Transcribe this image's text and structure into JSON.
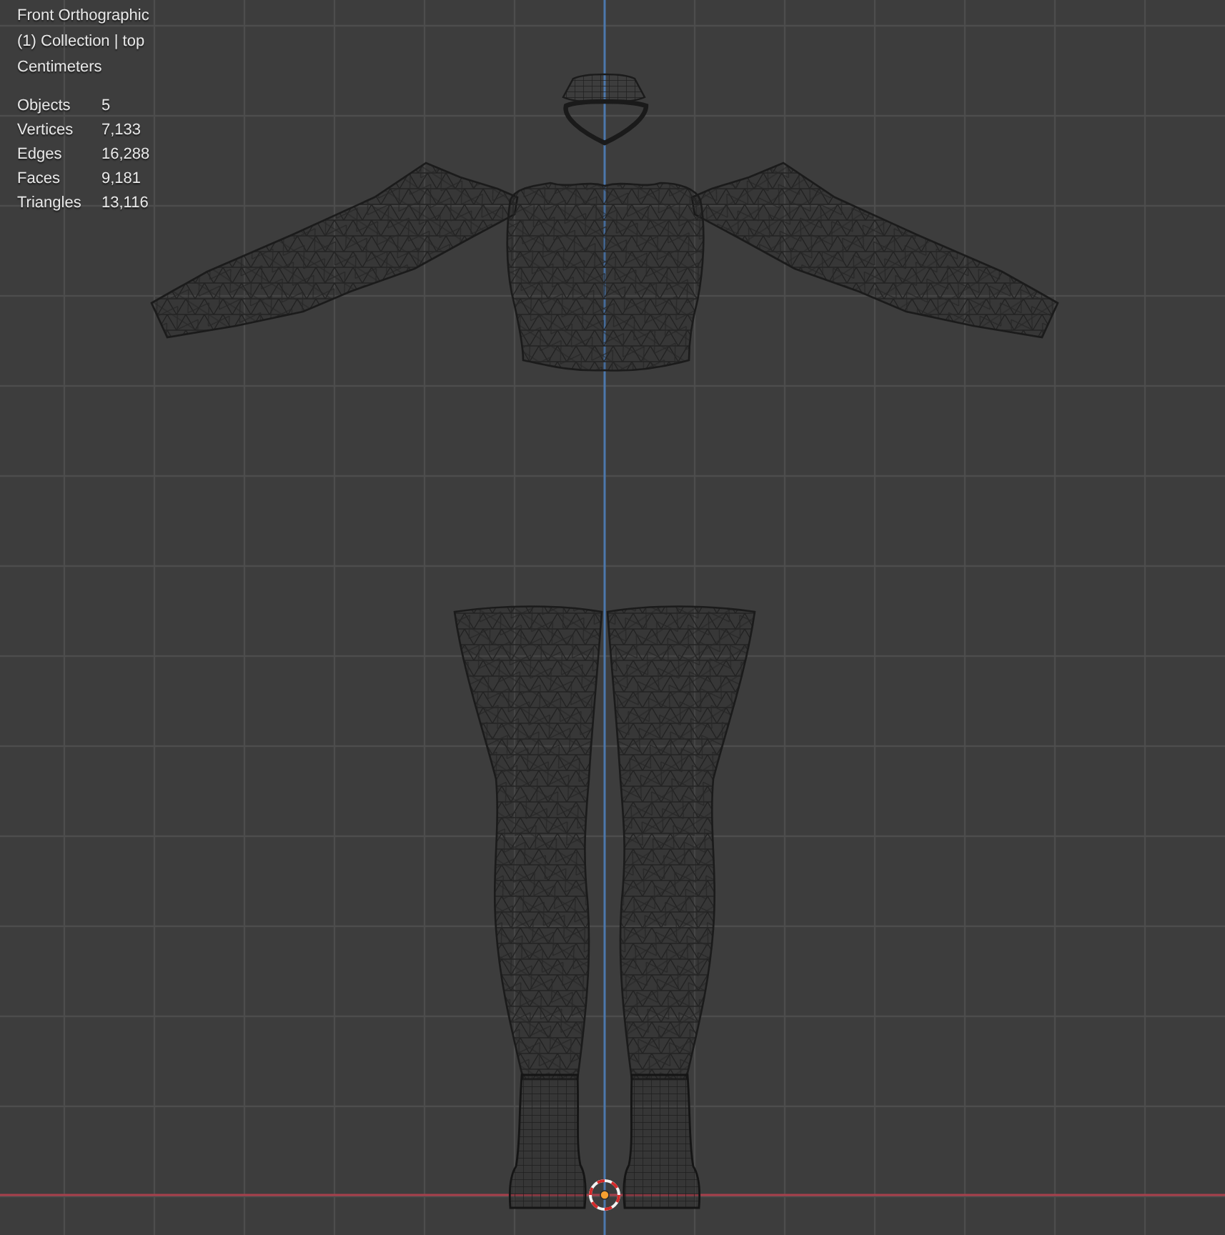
{
  "overlay": {
    "view_name": "Front Orthographic",
    "collection": "(1) Collection | top",
    "units": "Centimeters"
  },
  "statistics": [
    {
      "label": "Objects",
      "value": "5"
    },
    {
      "label": "Vertices",
      "value": "7,133"
    },
    {
      "label": "Edges",
      "value": "16,288"
    },
    {
      "label": "Faces",
      "value": "9,181"
    },
    {
      "label": "Triangles",
      "value": "13,116"
    }
  ]
}
